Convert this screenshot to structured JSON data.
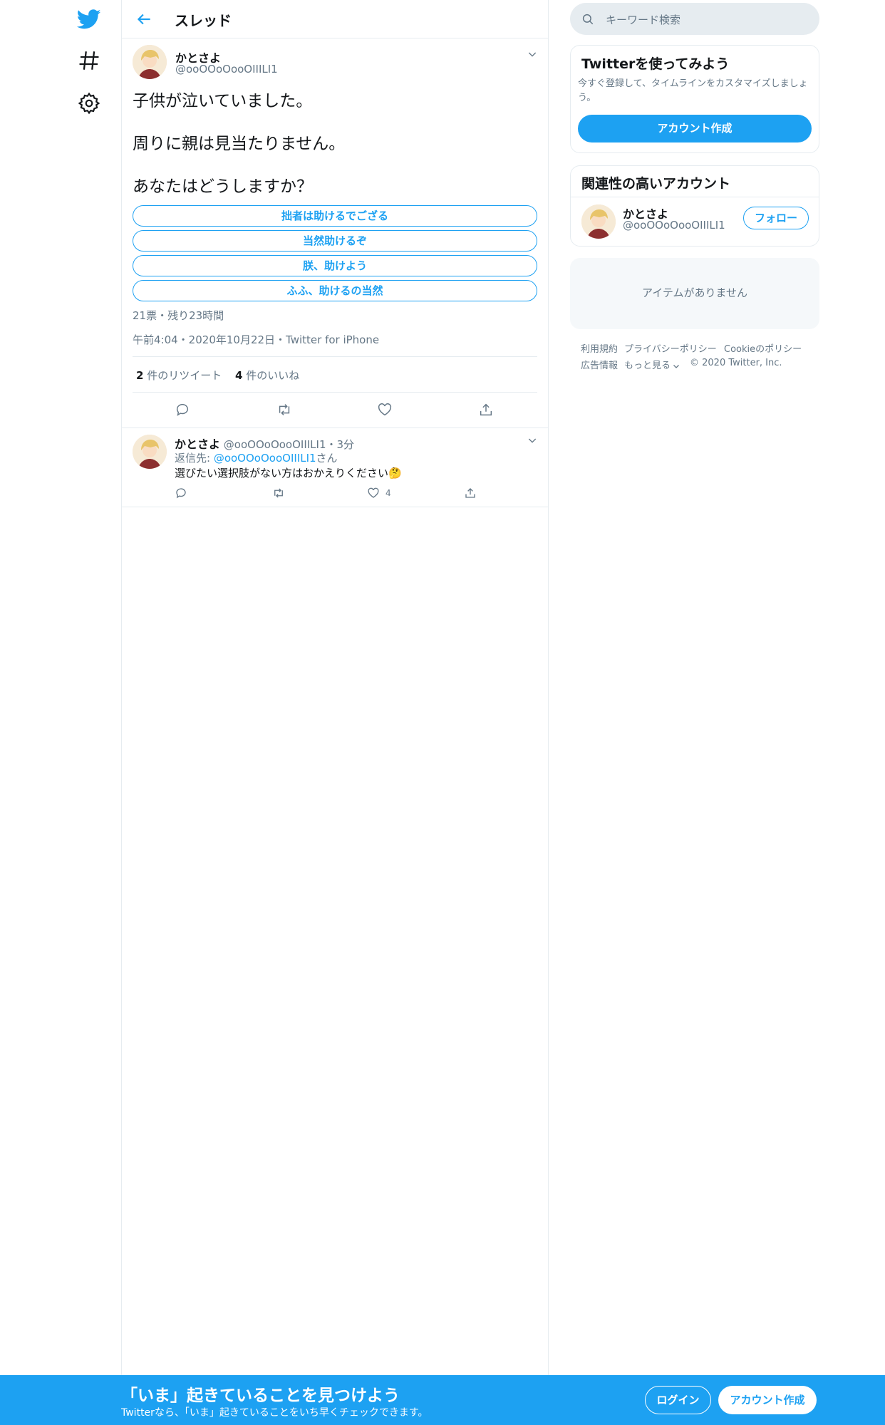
{
  "header": {
    "title": "スレッド"
  },
  "tweet": {
    "author_name": "かとさよ",
    "author_handle": "@ooOOoOooOIIILI1",
    "lines": [
      "子供が泣いていました。",
      "周りに親は見当たりません。",
      "あなたはどうしますか？"
    ],
    "poll": {
      "options": [
        "拙者は助けるでござる",
        "当然助けるぞ",
        "朕、助けよう",
        "ふふ、助けるの当然"
      ],
      "summary": "21票・残り23時間"
    },
    "timestamp": "午前4:04・2020年10月22日・Twitter for iPhone",
    "retweets": {
      "count": "2",
      "label": "件のリツイート"
    },
    "likes": {
      "count": "4",
      "label": "件のいいね"
    }
  },
  "reply": {
    "author_name": "かとさよ",
    "author_handle": "@ooOOoOooOIIILI1",
    "time": "・3分",
    "reply_to_prefix": "返信先: ",
    "reply_to_handle": "@ooOOoOooOIIILI1",
    "reply_to_suffix": "さん",
    "text": "選びたい選択肢がない方はおかえりください",
    "emoji": "🤔",
    "like_count": "4"
  },
  "sidebar": {
    "search_placeholder": "キーワード検索",
    "signup_card": {
      "title": "Twitterを使ってみよう",
      "description": "今すぐ登録して、タイムラインをカスタマイズしましょう。",
      "button": "アカウント作成"
    },
    "related": {
      "title": "関連性の高いアカウント",
      "name": "かとさよ",
      "handle": "@ooOOoOooOIIILI1",
      "follow": "フォロー"
    },
    "empty": "アイテムがありません",
    "footer": {
      "terms": "利用規約",
      "privacy": "プライバシーポリシー",
      "cookie": "Cookieのポリシー",
      "ads": "広告情報",
      "more": "もっと見る",
      "copyright": "© 2020 Twitter, Inc."
    }
  },
  "banner": {
    "title": "「いま」起きていることを見つけよう",
    "subtitle": "Twitterなら、「いま」起きていることをいち早くチェックできます。",
    "login": "ログイン",
    "signup": "アカウント作成"
  },
  "colors": {
    "accent": "#1da1f2",
    "muted": "#657786",
    "border": "#e6ecf0"
  },
  "icons": [
    "twitter-logo-icon",
    "hashtag-icon",
    "gear-icon",
    "back-arrow-icon",
    "chevron-down-icon",
    "reply-icon",
    "retweet-icon",
    "like-icon",
    "share-icon",
    "search-icon"
  ]
}
